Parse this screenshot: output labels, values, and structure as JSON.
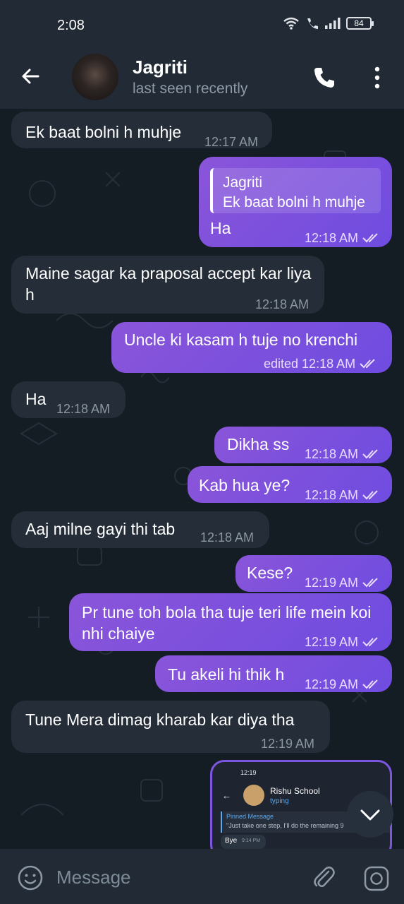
{
  "status_bar": {
    "time": "2:08",
    "battery": "84"
  },
  "header": {
    "name": "Jagriti",
    "status": "last seen recently"
  },
  "messages": [
    {
      "dir": "in",
      "text": "Ek baat bolni h muhje",
      "time": "12:17 AM"
    },
    {
      "dir": "out",
      "reply_name": "Jagriti",
      "reply_text": "Ek baat bolni h muhje",
      "text": "Ha",
      "time": "12:18 AM"
    },
    {
      "dir": "in",
      "text": "Maine sagar ka praposal accept kar liya h",
      "time": "12:18 AM"
    },
    {
      "dir": "out",
      "text": "Uncle ki kasam h tuje no krenchi",
      "time": "edited 12:18 AM"
    },
    {
      "dir": "in",
      "text": "Ha",
      "time": "12:18 AM"
    },
    {
      "dir": "out",
      "text": "Dikha ss",
      "time": "12:18 AM"
    },
    {
      "dir": "out",
      "text": "Kab hua ye?",
      "time": "12:18 AM"
    },
    {
      "dir": "in",
      "text": "Aaj milne gayi thi tab",
      "time": "12:18 AM"
    },
    {
      "dir": "out",
      "text": "Kese?",
      "time": "12:19 AM"
    },
    {
      "dir": "out",
      "text": "Pr tune toh bola tha tuje teri life mein koi nhi chaiye",
      "time": "12:19 AM"
    },
    {
      "dir": "out",
      "text": "Tu akeli hi thik h",
      "time": "12:19 AM"
    },
    {
      "dir": "in",
      "text": "Tune Mera dimag kharab kar diya tha",
      "time": "12:19 AM"
    }
  ],
  "screenshot_preview": {
    "time": "12:19",
    "contact": "Rishu School",
    "status": "typing",
    "pinned_title": "Pinned Message",
    "pinned_text": "\"Just take one step, I'll do the remaining 9",
    "last_msg": "Bye",
    "last_time": "9:14 PM"
  },
  "input": {
    "placeholder": "Message"
  },
  "colors": {
    "outgoing": "#7b52dc",
    "incoming": "#242d38",
    "background": "#141c24",
    "header": "#222b35"
  }
}
